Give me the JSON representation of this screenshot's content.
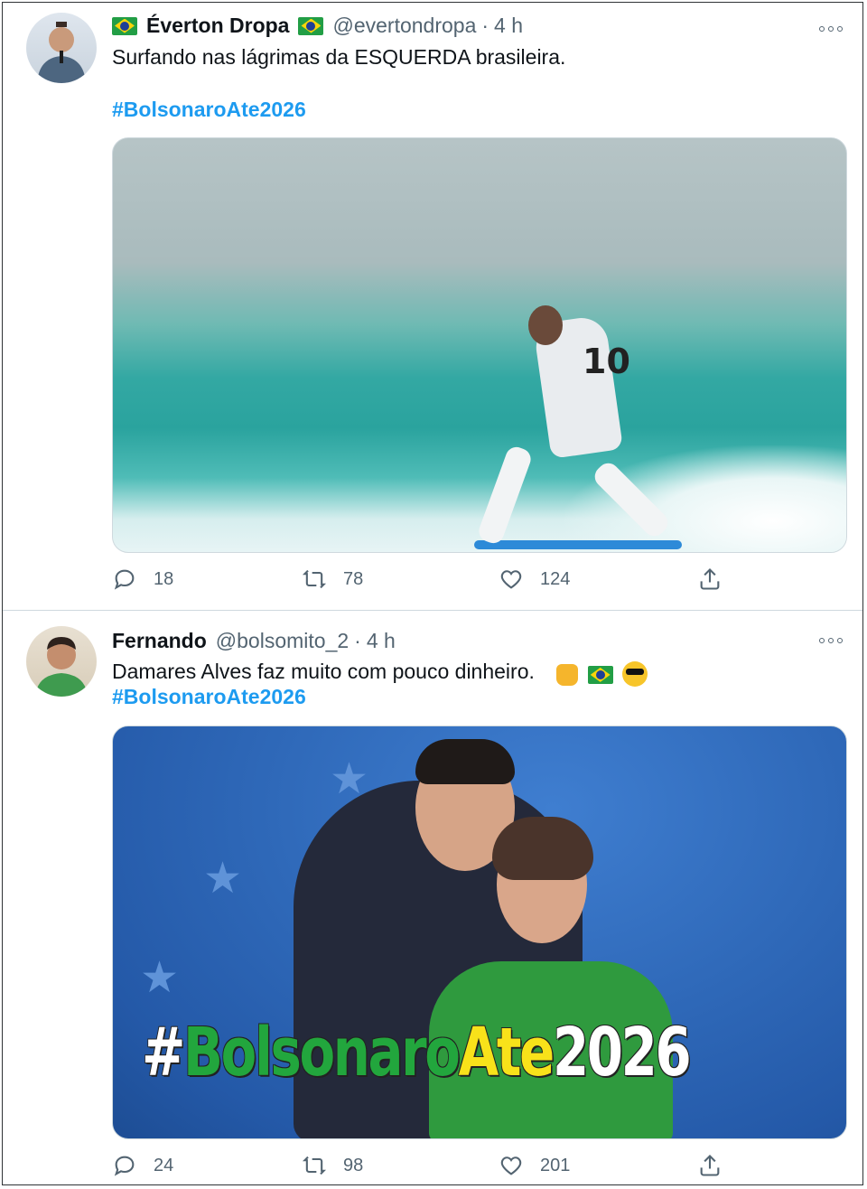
{
  "tweets": [
    {
      "name": "Éverton Dropa",
      "handle": "@evertondropa",
      "separator": "·",
      "time": "4 h",
      "text": "Surfando nas lágrimas da ESQUERDA brasileira.",
      "hashtag": "#BolsonaroAte2026",
      "media_description_icon": "surf-photo",
      "stats": {
        "replies": "18",
        "retweets": "78",
        "likes": "124"
      }
    },
    {
      "name": "Fernando",
      "handle": "@bolsomito_2",
      "separator": "·",
      "time": "4 h",
      "text": "Damares Alves faz muito com pouco dinheiro.",
      "hashtag": "#BolsonaroAte2026",
      "media_overlay": {
        "hash": "#",
        "green": "Bolsonaro",
        "yellow": "Ate",
        "white": "2026"
      },
      "media_description_icon": "hug-photo",
      "stats": {
        "replies": "24",
        "retweets": "98",
        "likes": "201"
      }
    }
  ],
  "icons": {
    "reply": "reply-icon",
    "retweet": "retweet-icon",
    "like": "like-icon",
    "share": "share-icon",
    "more": "more-icon",
    "flag": "brazil-flag-icon"
  },
  "colors": {
    "link": "#1d9bf0",
    "secondary_text": "#536471",
    "divider": "#cfd9de"
  }
}
